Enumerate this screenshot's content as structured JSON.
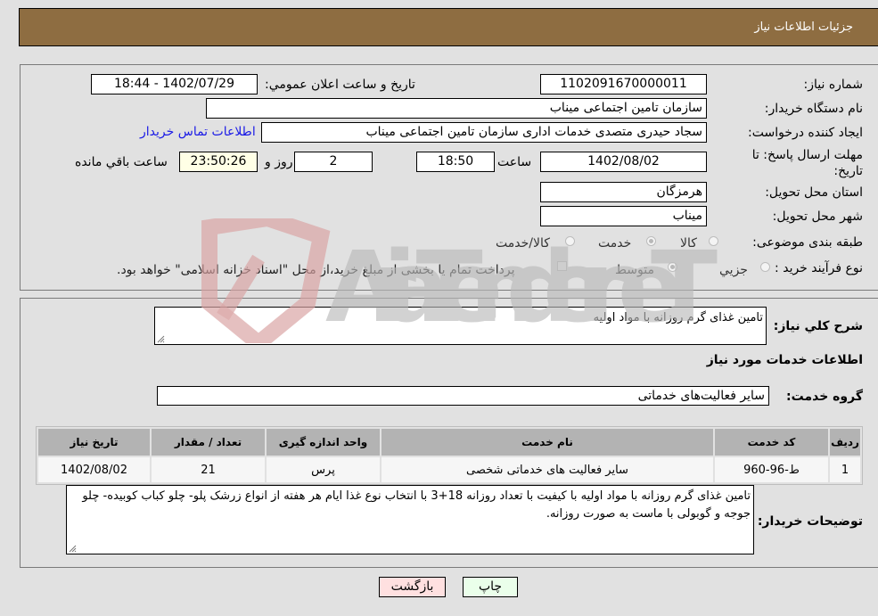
{
  "header": {
    "title": "جزئیات اطلاعات نیاز"
  },
  "form": {
    "need_number": {
      "label": "شماره نیاز:",
      "value": "1102091670000011"
    },
    "announce_datetime": {
      "label": "تاریخ و ساعت اعلان عمومي:",
      "value": "1402/07/29 - 18:44"
    },
    "buyer_org": {
      "label": "نام دستگاه خریدار:",
      "value": "سازمان تامین اجتماعی میناب"
    },
    "requester": {
      "label": "ایجاد کننده درخواست:",
      "value": "سجاد حیدری متصدی خدمات اداری سازمان تامین اجتماعی میناب"
    },
    "buyer_contact_link": "اطلاعات تماس خریدار",
    "deadline": {
      "label_line1": "مهلت ارسال پاسخ: تا",
      "label_line2": "تاریخ:",
      "date": "1402/08/02",
      "time_label": "ساعت",
      "time": "18:50",
      "days": "2",
      "days_label": "روز و",
      "remaining": "23:50:26",
      "remaining_label": "ساعت باقي مانده"
    },
    "province": {
      "label": "استان محل تحویل:",
      "value": "هرمزگان"
    },
    "city": {
      "label": "شهر محل تحویل:",
      "value": "میناب"
    },
    "category": {
      "label": "طبقه بندی موضوعی:",
      "options": [
        "کالا",
        "خدمت",
        "کالا/خدمت"
      ],
      "selected": "خدمت"
    },
    "purchase_type": {
      "label": "نوع فرآیند خرید :",
      "options": [
        "جزيي",
        "متوسط"
      ],
      "selected": "متوسط",
      "treasury_checkbox_label": "پرداخت تمام یا بخشی از مبلغ خرید،از محل \"اسناد خزانه اسلامی\" خواهد بود.",
      "treasury_checked": false
    }
  },
  "details": {
    "summary": {
      "label": "شرح کلي نیاز:",
      "value": "تامین غذای گرم روزانه با مواد اولیه"
    },
    "services_heading": "اطلاعات خدمات مورد نیاز",
    "service_group": {
      "label": "گروه خدمت:",
      "value": "سایر فعالیت‌های خدماتی"
    },
    "table": {
      "headers": [
        "ردیف",
        "کد خدمت",
        "نام خدمت",
        "واحد اندازه گیری",
        "تعداد / مقدار",
        "تاریخ نیاز"
      ],
      "rows": [
        [
          "1",
          "ط-96-960",
          "سایر فعالیت های خدماتی شخصی",
          "پرس",
          "21",
          "1402/08/02"
        ]
      ]
    },
    "buyer_notes": {
      "label": "توضیحات خریدار:",
      "value": "تامین غذای گرم روزانه با مواد اولیه با کیفیت با تعداد روزانه 18+3 با انتخاب نوع غذا ایام هر هفته از انواع زرشک پلو- چلو کباب کوبیده- چلو جوجه و گوبولی با ماست به صورت روزانه."
    }
  },
  "buttons": {
    "print": "چاپ",
    "back": "بازگشت"
  },
  "watermark": {
    "text": "AriaTender.neT"
  },
  "colors": {
    "header_bg": "#8e6d41",
    "link": "#1a1ae6",
    "print_btn_bg": "#eaffea",
    "back_btn_bg": "#ffe0e0",
    "remaining_bg": "#ffffe6"
  }
}
